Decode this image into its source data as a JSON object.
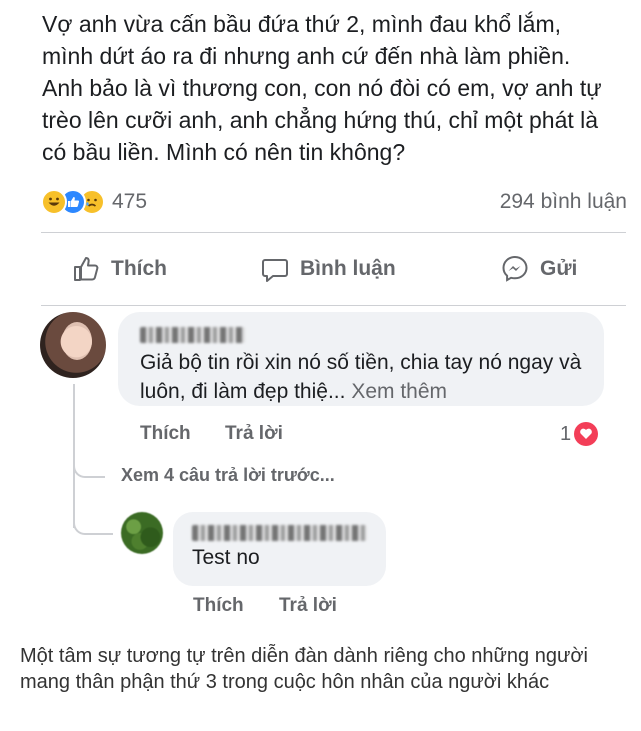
{
  "post": {
    "text": "Vợ anh vừa cấn bầu đứa thứ 2, mình đau khổ lắm,\nmình dứt áo ra đi nhưng anh cứ đến nhà làm phiền.\nAnh bảo là vì thương con, con nó đòi có em, vợ anh tự\ntrèo lên cưỡi anh, anh chẳng hứng thú, chỉ một phát là\ncó bầu liền. Mình có nên tin không?",
    "reaction_count": "475",
    "comment_count": "294 bình luận",
    "reaction_icons": [
      "haha-icon",
      "like-icon",
      "sad-icon"
    ]
  },
  "actions": {
    "like_label": "Thích",
    "comment_label": "Bình luận",
    "share_label": "Gửi"
  },
  "comment": {
    "text": "Giả bộ tin rồi xin nó số tiền, chia tay nó ngay và luôn, đi làm đẹp thiệ...",
    "see_more": "Xem thêm",
    "like_label": "Thích",
    "reply_label": "Trả lời",
    "like_count": "1"
  },
  "thread": {
    "view_previous": "Xem 4 câu trả lời trước..."
  },
  "reply": {
    "text": "Test no",
    "like_label": "Thích",
    "reply_label": "Trả lời"
  },
  "caption": "Một tâm sự tương tự trên diễn đàn dành riêng cho những người mang thân phận thứ 3 trong cuộc hôn nhân của người khác",
  "colors": {
    "secondary_text": "#65676b",
    "bubble": "#f0f2f5",
    "like_blue": "#2d88ff",
    "heart_red": "#f33e58"
  }
}
